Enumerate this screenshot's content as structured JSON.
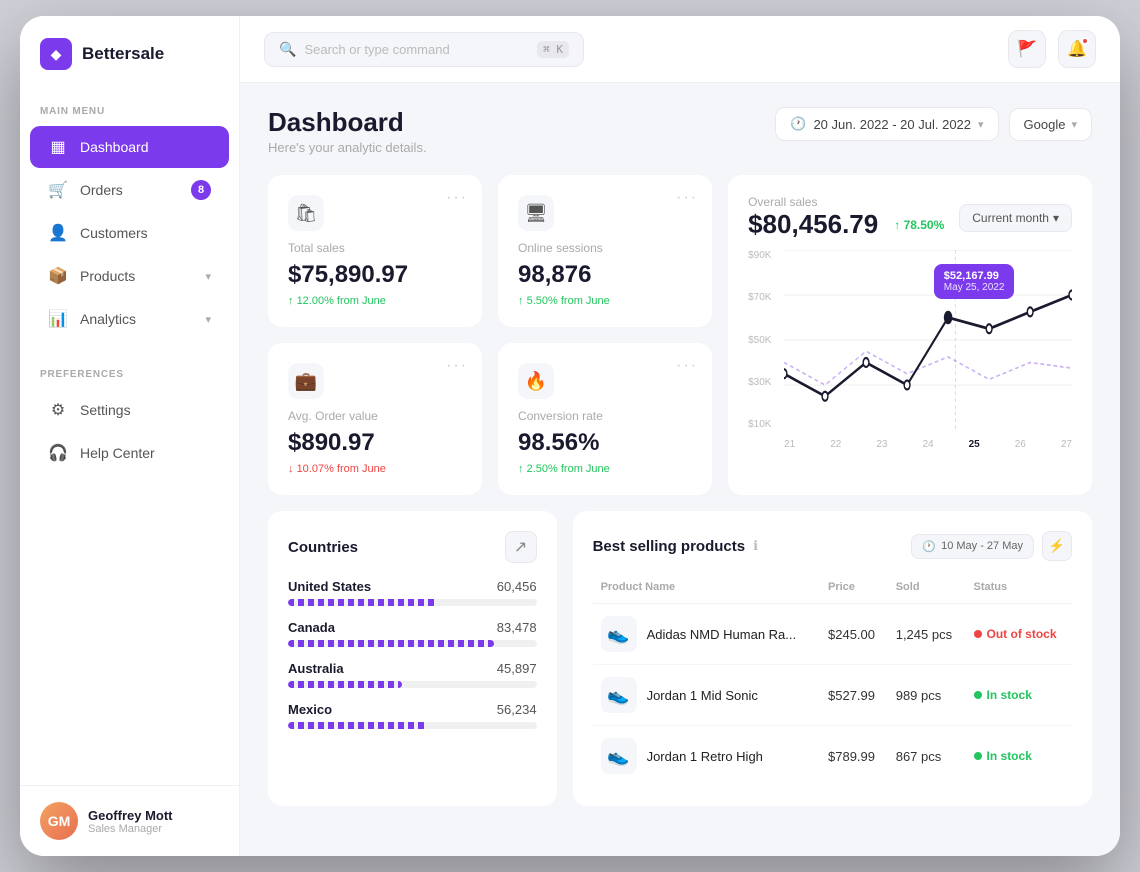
{
  "app": {
    "name": "Bettersale"
  },
  "topbar": {
    "search_placeholder": "Search or type command",
    "kbd_shortcut": "⌘ K"
  },
  "sidebar": {
    "main_menu_label": "MAIN MENU",
    "preferences_label": "PREFERENCES",
    "nav_items": [
      {
        "id": "dashboard",
        "label": "Dashboard",
        "icon": "▦",
        "active": true,
        "badge": null,
        "chevron": false
      },
      {
        "id": "orders",
        "label": "Orders",
        "icon": "🛒",
        "active": false,
        "badge": "8",
        "chevron": false
      },
      {
        "id": "customers",
        "label": "Customers",
        "icon": "👤",
        "active": false,
        "badge": null,
        "chevron": false
      },
      {
        "id": "products",
        "label": "Products",
        "icon": "📦",
        "active": false,
        "badge": null,
        "chevron": true
      },
      {
        "id": "analytics",
        "label": "Analytics",
        "icon": "📊",
        "active": false,
        "badge": null,
        "chevron": true
      }
    ],
    "pref_items": [
      {
        "id": "settings",
        "label": "Settings",
        "icon": "⚙"
      },
      {
        "id": "help",
        "label": "Help Center",
        "icon": "🎧"
      }
    ],
    "user": {
      "name": "Geoffrey Mott",
      "role": "Sales Manager",
      "initials": "GM"
    }
  },
  "page": {
    "title": "Dashboard",
    "subtitle": "Here's your analytic details.",
    "date_range": "20 Jun. 2022 - 20 Jul. 2022",
    "source": "Google"
  },
  "stats": [
    {
      "id": "total-sales",
      "label": "Total sales",
      "value": "$75,890.97",
      "change": "12.00% from June",
      "change_dir": "up",
      "icon": "🛍"
    },
    {
      "id": "online-sessions",
      "label": "Online sessions",
      "value": "98,876",
      "change": "5.50% from June",
      "change_dir": "up",
      "icon": "🖥"
    },
    {
      "id": "avg-order",
      "label": "Avg. Order value",
      "value": "$890.97",
      "change": "10.07% from June",
      "change_dir": "down",
      "icon": "💼"
    },
    {
      "id": "conversion",
      "label": "Conversion rate",
      "value": "98.56%",
      "change": "2.50% from June",
      "change_dir": "up",
      "icon": "🔥"
    }
  ],
  "chart": {
    "label": "Overall sales",
    "value": "$80,456.79",
    "change": "78.50%",
    "period_btn": "Current month",
    "tooltip_value": "$52,167.99",
    "tooltip_date": "May 25, 2022",
    "y_labels": [
      "$90K",
      "$70K",
      "$50K",
      "$30K",
      "$10K"
    ],
    "x_labels": [
      "21",
      "22",
      "23",
      "24",
      "25",
      "26",
      "27"
    ]
  },
  "countries": {
    "title": "Countries",
    "items": [
      {
        "name": "United States",
        "value": "60,456",
        "pct": 60
      },
      {
        "name": "Canada",
        "value": "83,478",
        "pct": 83
      },
      {
        "name": "Australia",
        "value": "45,897",
        "pct": 46
      },
      {
        "name": "Mexico",
        "value": "56,234",
        "pct": 56
      }
    ]
  },
  "products": {
    "title": "Best selling products",
    "date_range": "10 May - 27 May",
    "columns": [
      "Product name",
      "Price",
      "Sold",
      "Status"
    ],
    "items": [
      {
        "name": "Adidas NMD Human Ra...",
        "price": "$245.00",
        "sold": "1,245 pcs",
        "status": "Out of stock",
        "status_type": "out",
        "emoji": "👟"
      },
      {
        "name": "Jordan 1 Mid Sonic",
        "price": "$527.99",
        "sold": "989 pcs",
        "status": "In stock",
        "status_type": "in",
        "emoji": "👟"
      },
      {
        "name": "Jordan 1 Retro High",
        "price": "$789.99",
        "sold": "867 pcs",
        "status": "In stock",
        "status_type": "in",
        "emoji": "👟"
      }
    ]
  }
}
